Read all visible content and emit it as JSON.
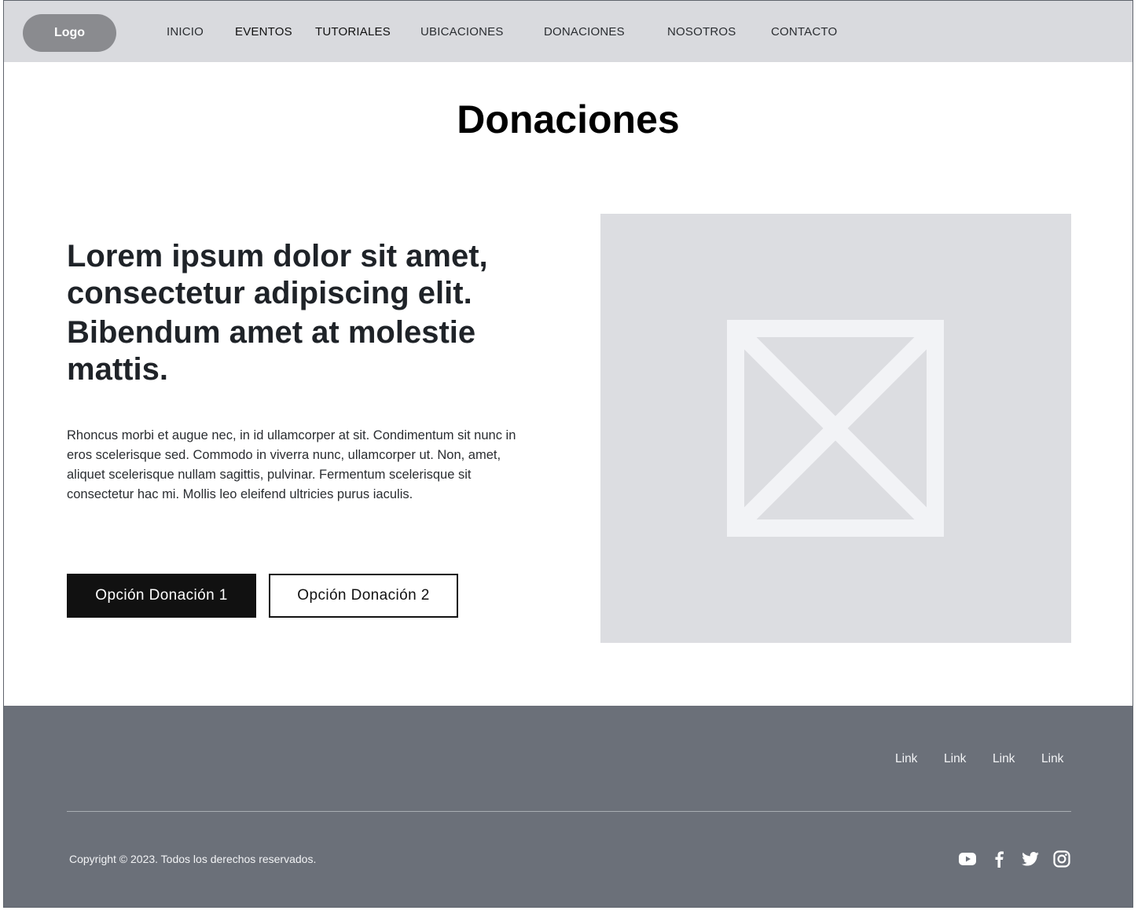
{
  "header": {
    "logo": "Logo",
    "nav": [
      "INICIO",
      "EVENTOS",
      "TUTORIALES",
      "UBICACIONES",
      "DONACIONES",
      "NOSOTROS",
      "CONTACTO"
    ]
  },
  "main": {
    "title": "Donaciones",
    "heading_lines": [
      "Lorem ipsum dolor sit amet,",
      "consectetur adipiscing elit.",
      "Bibendum amet at molestie",
      "mattis."
    ],
    "body_text": "Rhoncus morbi et augue nec, in id ullamcorper at sit. Condimentum sit nunc in eros scelerisque sed. Commodo in viverra nunc, ullamcorper ut. Non, amet, aliquet scelerisque nullam sagittis, pulvinar. Fermentum scelerisque sit consectetur hac mi. Mollis leo eleifend ultricies purus iaculis.",
    "button_primary": "Opción Donación 1",
    "button_secondary": "Opción Donación 2"
  },
  "footer": {
    "links": [
      "Link",
      "Link",
      "Link",
      "Link"
    ],
    "copyright": "Copyright © 2023. Todos los derechos reservados.",
    "social_icons": [
      "youtube-icon",
      "facebook-icon",
      "twitter-icon",
      "instagram-icon"
    ]
  },
  "colors": {
    "header_bg": "#d9dade",
    "logo_bg": "#8a8b8f",
    "footer_bg": "#6b7079",
    "placeholder_bg": "#dcdde1",
    "primary_button": "#111111"
  }
}
